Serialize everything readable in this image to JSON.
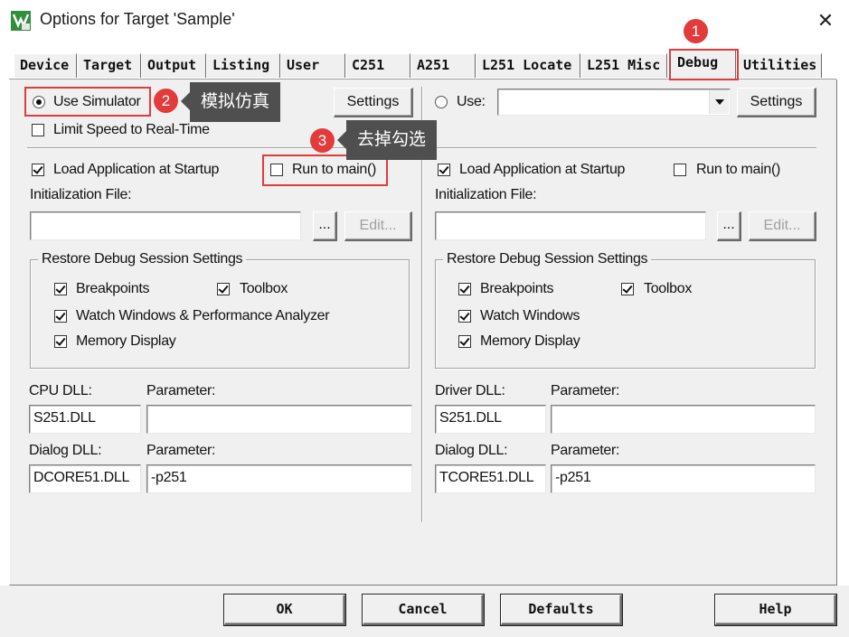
{
  "window": {
    "title": "Options for Target 'Sample'",
    "close_glyph": "✕",
    "app_icon_text": "μ"
  },
  "tabs": [
    {
      "label": "Device",
      "active": false
    },
    {
      "label": "Target",
      "active": false
    },
    {
      "label": "Output",
      "active": false
    },
    {
      "label": "Listing",
      "active": false
    },
    {
      "label": "User",
      "active": false
    },
    {
      "label": "C251",
      "active": false
    },
    {
      "label": "A251",
      "active": false
    },
    {
      "label": "L251 Locate",
      "active": false
    },
    {
      "label": "L251 Misc",
      "active": false
    },
    {
      "label": "Debug",
      "active": true
    },
    {
      "label": "Utilities",
      "active": false
    }
  ],
  "left": {
    "use_simulator": {
      "label": "Use Simulator",
      "checked": true
    },
    "settings_button": "Settings",
    "limit_speed": {
      "label": "Limit Speed to Real-Time",
      "checked": false
    },
    "load_app": {
      "label": "Load Application at Startup",
      "checked": true
    },
    "run_to_main": {
      "label": "Run to main()",
      "checked": false
    },
    "init_file_label": "Initialization File:",
    "init_file_value": "",
    "browse_button": "...",
    "edit_button": "Edit...",
    "restore_group": {
      "title": "Restore Debug Session Settings",
      "breakpoints": {
        "label": "Breakpoints",
        "checked": true
      },
      "toolbox": {
        "label": "Toolbox",
        "checked": true
      },
      "watch_windows": {
        "label": "Watch Windows & Performance Analyzer",
        "checked": true
      },
      "memory_display": {
        "label": "Memory Display",
        "checked": true
      }
    },
    "cpu_dll_label": "CPU DLL:",
    "cpu_dll_value": "S251.DLL",
    "cpu_param_label": "Parameter:",
    "cpu_param_value": "",
    "dialog_dll_label": "Dialog DLL:",
    "dialog_dll_value": "DCORE51.DLL",
    "dialog_param_label": "Parameter:",
    "dialog_param_value": "-p251"
  },
  "right": {
    "use": {
      "label": "Use:",
      "checked": false
    },
    "driver_select_value": "",
    "settings_button": "Settings",
    "load_app": {
      "label": "Load Application at Startup",
      "checked": true
    },
    "run_to_main": {
      "label": "Run to main()",
      "checked": false
    },
    "init_file_label": "Initialization File:",
    "init_file_value": "",
    "browse_button": "...",
    "edit_button": "Edit...",
    "restore_group": {
      "title": "Restore Debug Session Settings",
      "breakpoints": {
        "label": "Breakpoints",
        "checked": true
      },
      "toolbox": {
        "label": "Toolbox",
        "checked": true
      },
      "watch_windows": {
        "label": "Watch Windows",
        "checked": true
      },
      "memory_display": {
        "label": "Memory Display",
        "checked": true
      }
    },
    "driver_dll_label": "Driver DLL:",
    "driver_dll_value": "S251.DLL",
    "driver_param_label": "Parameter:",
    "driver_param_value": "",
    "dialog_dll_label": "Dialog DLL:",
    "dialog_dll_value": "TCORE51.DLL",
    "dialog_param_label": "Parameter:",
    "dialog_param_value": "-p251"
  },
  "footer": {
    "ok": "OK",
    "cancel": "Cancel",
    "defaults": "Defaults",
    "help": "Help"
  },
  "annotations": [
    {
      "number": "1",
      "text": ""
    },
    {
      "number": "2",
      "text": "模拟仿真"
    },
    {
      "number": "3",
      "text": "去掉勾选"
    }
  ],
  "colors": {
    "annotation_red": "#e23b3b",
    "tooltip_gray": "#4f4f4f",
    "dialog_face": "#f0f0f0"
  }
}
